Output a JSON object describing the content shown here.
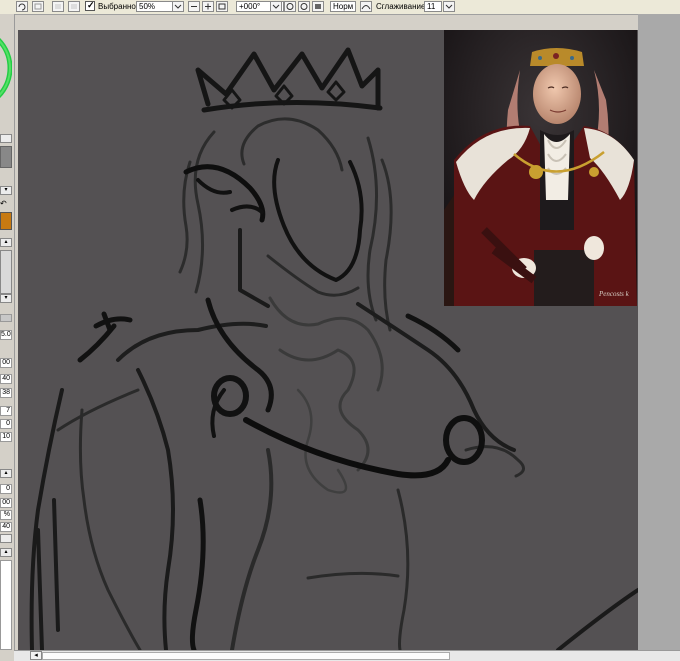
{
  "toolbar": {
    "selected_label": "Выбранное",
    "zoom_value": "50%",
    "rotation_value": "+000°",
    "blend_mode": "Норм",
    "smoothing_label": "Сглаживание",
    "smoothing_value": "11"
  },
  "left_panel": {
    "values": [
      "5.0",
      "00",
      "40",
      "38",
      "7",
      "0",
      "10",
      "0",
      "00",
      "%",
      "40"
    ]
  },
  "reference": {
    "signature": "Pencosts k"
  },
  "colors": {
    "canvas": "#545153",
    "workspace": "#a9a9a9",
    "swatch": "#c77a12"
  }
}
